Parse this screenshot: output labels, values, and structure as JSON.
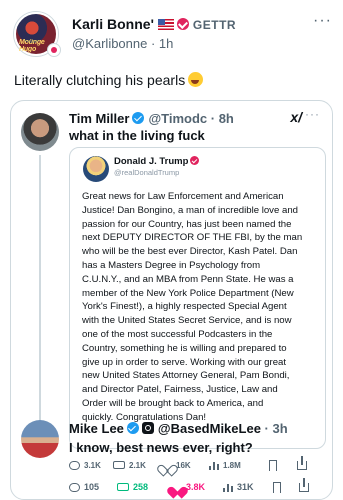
{
  "post": {
    "author_name": "Karli Bonne'",
    "platform_label": "GETTR",
    "handle": "@Karlibonne",
    "time": "1h",
    "text": "Literally clutching his pearls",
    "more": "···",
    "avatar_text": "Moünge Hugo"
  },
  "quote": {
    "author_name": "Tim Miller",
    "handle": "@Timodc",
    "time": "8h",
    "text": "what in the living fuck",
    "grok_label": "x/",
    "more": "···",
    "screenshot": {
      "author_name": "Donald J. Trump",
      "handle": "@realDonaldTrump",
      "body": "Great news for Law Enforcement and American\nJustice! Dan Bongino, a man of incredible love and\npassion for our Country, has just been named the\nnext DEPUTY DIRECTOR OF THE FBI, by the man\nwho will be the best ever Director, Kash Patel. Dan\nhas a Masters Degree in Psychology from\nC.U.N.Y., and an MBA from Penn State. He was a\nmember of the New York Police Department (New\nYork's Finest!), a highly respected Special Agent\nwith the United States Secret Service, and is now\none of the most successful Podcasters in the\nCountry, something he is willing and prepared to\ngive up in order to serve. Working with our great\nnew United States Attorney General, Pam Bondi,\nand Director Patel, Fairness, Justice, Law and\nOrder will be brought back to America, and\nquickly. Congratulations Dan!"
    },
    "stats": {
      "replies": "3.1K",
      "reposts": "2.1K",
      "likes": "16K",
      "views": "1.8M"
    }
  },
  "reply": {
    "author_name": "Mike Lee",
    "handle": "@BasedMikeLee",
    "time": "3h",
    "text": "I know, best news ever, right?",
    "stats": {
      "replies": "105",
      "reposts": "258",
      "likes": "3.8K",
      "views": "31K"
    }
  },
  "colors": {
    "accent_blue": "#1d9bf0",
    "like_pink": "#f91880",
    "repost_green": "#00ba7c",
    "muted": "#536471"
  },
  "icons": {
    "reply": "reply-icon",
    "repost": "repost-icon",
    "like": "heart-icon",
    "views": "views-icon",
    "bookmark": "bookmark-icon",
    "share": "share-icon"
  }
}
